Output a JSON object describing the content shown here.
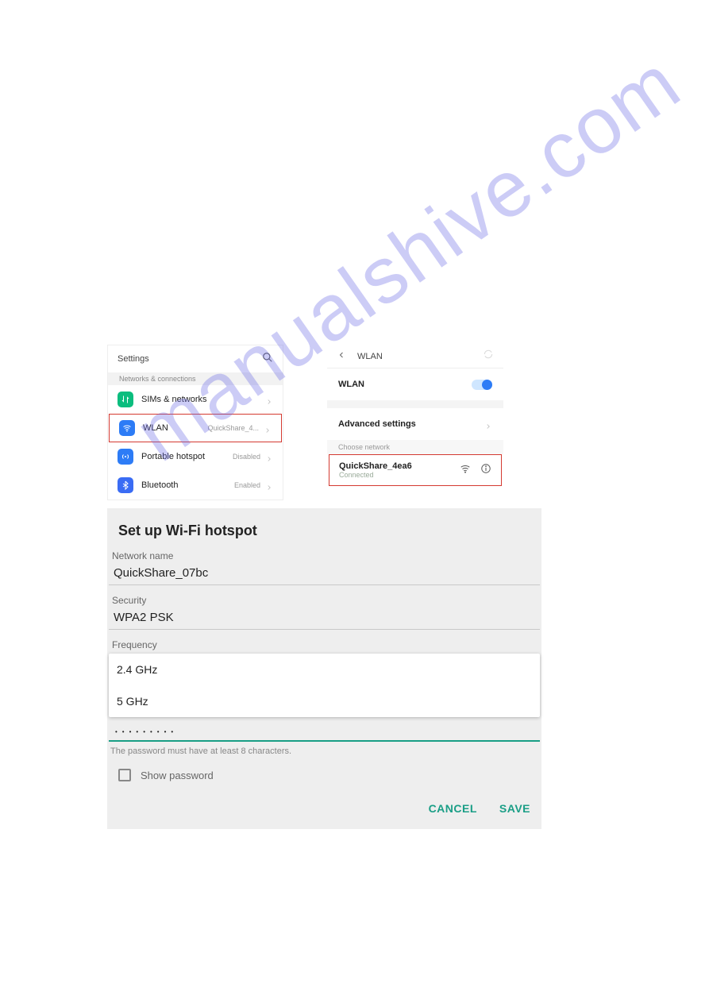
{
  "watermark": "manualshive.com",
  "settings": {
    "title": "Settings",
    "section": "Networks & connections",
    "items": [
      {
        "label": "SIMs & networks",
        "value": "",
        "icon": "data-transfer-icon",
        "color": "ic-green",
        "highlight": false
      },
      {
        "label": "WLAN",
        "value": "QuickShare_4...",
        "icon": "wifi-icon",
        "color": "ic-blue",
        "highlight": true
      },
      {
        "label": "Portable hotspot",
        "value": "Disabled",
        "icon": "hotspot-icon",
        "color": "ic-blue2",
        "highlight": false
      },
      {
        "label": "Bluetooth",
        "value": "Enabled",
        "icon": "bluetooth-icon",
        "color": "ic-bt",
        "highlight": false
      }
    ]
  },
  "wlan": {
    "title": "WLAN",
    "toggle_label": "WLAN",
    "advanced": "Advanced settings",
    "choose": "Choose network",
    "network": {
      "name": "QuickShare_4ea6",
      "status": "Connected"
    }
  },
  "hotspot": {
    "title": "Set up Wi-Fi hotspot",
    "network_name_label": "Network name",
    "network_name_value": "QuickShare_07bc",
    "security_label": "Security",
    "security_value": "WPA2 PSK",
    "frequency_label": "Frequency",
    "frequency_options": [
      "2.4 GHz",
      "5 GHz"
    ],
    "password_dots": "•••••••••",
    "hint": "The password must have at least 8 characters.",
    "show_password": "Show password",
    "cancel": "CANCEL",
    "save": "SAVE"
  }
}
